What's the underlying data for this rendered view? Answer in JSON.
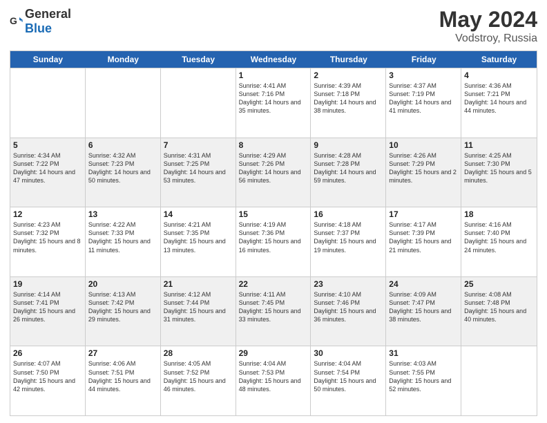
{
  "logo": {
    "general": "General",
    "blue": "Blue"
  },
  "title": {
    "month_year": "May 2024",
    "location": "Vodstroy, Russia"
  },
  "header_days": [
    "Sunday",
    "Monday",
    "Tuesday",
    "Wednesday",
    "Thursday",
    "Friday",
    "Saturday"
  ],
  "rows": [
    [
      {
        "day": "",
        "info": ""
      },
      {
        "day": "",
        "info": ""
      },
      {
        "day": "",
        "info": ""
      },
      {
        "day": "1",
        "info": "Sunrise: 4:41 AM\nSunset: 7:16 PM\nDaylight: 14 hours\nand 35 minutes."
      },
      {
        "day": "2",
        "info": "Sunrise: 4:39 AM\nSunset: 7:18 PM\nDaylight: 14 hours\nand 38 minutes."
      },
      {
        "day": "3",
        "info": "Sunrise: 4:37 AM\nSunset: 7:19 PM\nDaylight: 14 hours\nand 41 minutes."
      },
      {
        "day": "4",
        "info": "Sunrise: 4:36 AM\nSunset: 7:21 PM\nDaylight: 14 hours\nand 44 minutes."
      }
    ],
    [
      {
        "day": "5",
        "info": "Sunrise: 4:34 AM\nSunset: 7:22 PM\nDaylight: 14 hours\nand 47 minutes."
      },
      {
        "day": "6",
        "info": "Sunrise: 4:32 AM\nSunset: 7:23 PM\nDaylight: 14 hours\nand 50 minutes."
      },
      {
        "day": "7",
        "info": "Sunrise: 4:31 AM\nSunset: 7:25 PM\nDaylight: 14 hours\nand 53 minutes."
      },
      {
        "day": "8",
        "info": "Sunrise: 4:29 AM\nSunset: 7:26 PM\nDaylight: 14 hours\nand 56 minutes."
      },
      {
        "day": "9",
        "info": "Sunrise: 4:28 AM\nSunset: 7:28 PM\nDaylight: 14 hours\nand 59 minutes."
      },
      {
        "day": "10",
        "info": "Sunrise: 4:26 AM\nSunset: 7:29 PM\nDaylight: 15 hours\nand 2 minutes."
      },
      {
        "day": "11",
        "info": "Sunrise: 4:25 AM\nSunset: 7:30 PM\nDaylight: 15 hours\nand 5 minutes."
      }
    ],
    [
      {
        "day": "12",
        "info": "Sunrise: 4:23 AM\nSunset: 7:32 PM\nDaylight: 15 hours\nand 8 minutes."
      },
      {
        "day": "13",
        "info": "Sunrise: 4:22 AM\nSunset: 7:33 PM\nDaylight: 15 hours\nand 11 minutes."
      },
      {
        "day": "14",
        "info": "Sunrise: 4:21 AM\nSunset: 7:35 PM\nDaylight: 15 hours\nand 13 minutes."
      },
      {
        "day": "15",
        "info": "Sunrise: 4:19 AM\nSunset: 7:36 PM\nDaylight: 15 hours\nand 16 minutes."
      },
      {
        "day": "16",
        "info": "Sunrise: 4:18 AM\nSunset: 7:37 PM\nDaylight: 15 hours\nand 19 minutes."
      },
      {
        "day": "17",
        "info": "Sunrise: 4:17 AM\nSunset: 7:39 PM\nDaylight: 15 hours\nand 21 minutes."
      },
      {
        "day": "18",
        "info": "Sunrise: 4:16 AM\nSunset: 7:40 PM\nDaylight: 15 hours\nand 24 minutes."
      }
    ],
    [
      {
        "day": "19",
        "info": "Sunrise: 4:14 AM\nSunset: 7:41 PM\nDaylight: 15 hours\nand 26 minutes."
      },
      {
        "day": "20",
        "info": "Sunrise: 4:13 AM\nSunset: 7:42 PM\nDaylight: 15 hours\nand 29 minutes."
      },
      {
        "day": "21",
        "info": "Sunrise: 4:12 AM\nSunset: 7:44 PM\nDaylight: 15 hours\nand 31 minutes."
      },
      {
        "day": "22",
        "info": "Sunrise: 4:11 AM\nSunset: 7:45 PM\nDaylight: 15 hours\nand 33 minutes."
      },
      {
        "day": "23",
        "info": "Sunrise: 4:10 AM\nSunset: 7:46 PM\nDaylight: 15 hours\nand 36 minutes."
      },
      {
        "day": "24",
        "info": "Sunrise: 4:09 AM\nSunset: 7:47 PM\nDaylight: 15 hours\nand 38 minutes."
      },
      {
        "day": "25",
        "info": "Sunrise: 4:08 AM\nSunset: 7:48 PM\nDaylight: 15 hours\nand 40 minutes."
      }
    ],
    [
      {
        "day": "26",
        "info": "Sunrise: 4:07 AM\nSunset: 7:50 PM\nDaylight: 15 hours\nand 42 minutes."
      },
      {
        "day": "27",
        "info": "Sunrise: 4:06 AM\nSunset: 7:51 PM\nDaylight: 15 hours\nand 44 minutes."
      },
      {
        "day": "28",
        "info": "Sunrise: 4:05 AM\nSunset: 7:52 PM\nDaylight: 15 hours\nand 46 minutes."
      },
      {
        "day": "29",
        "info": "Sunrise: 4:04 AM\nSunset: 7:53 PM\nDaylight: 15 hours\nand 48 minutes."
      },
      {
        "day": "30",
        "info": "Sunrise: 4:04 AM\nSunset: 7:54 PM\nDaylight: 15 hours\nand 50 minutes."
      },
      {
        "day": "31",
        "info": "Sunrise: 4:03 AM\nSunset: 7:55 PM\nDaylight: 15 hours\nand 52 minutes."
      },
      {
        "day": "",
        "info": ""
      }
    ]
  ]
}
